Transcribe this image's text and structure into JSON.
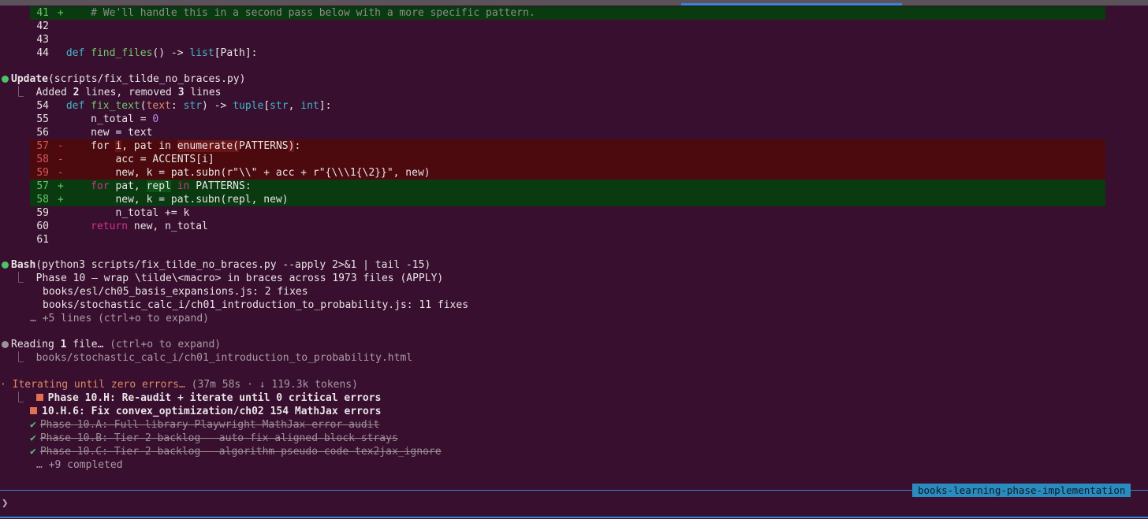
{
  "colors": {
    "background": "#380f2e",
    "added_bg": "#0a3a10",
    "removed_bg": "#4c0a0e",
    "accent": "#3a86d6",
    "branch_badge": "#2a8bbf",
    "success_dot": "#4cc26a",
    "task_square": "#e07050"
  },
  "diff1": {
    "lines": [
      {
        "num": "41",
        "mark": "+",
        "code": "# We'll handle this in a second pass below with a more specific pattern."
      },
      {
        "num": "42"
      },
      {
        "num": "43"
      },
      {
        "num": "44",
        "def": "def",
        "fname": "find_files",
        "rest1": "() -> ",
        "type": "list",
        "rest2": "[Path]:"
      }
    ]
  },
  "update": {
    "tool": "Update",
    "arg": "(scripts/fix_tilde_no_braces.py)",
    "summary_prefix": "Added ",
    "added": "2",
    "summary_mid": " lines, removed ",
    "removed": "3",
    "summary_suffix": " lines",
    "lines": [
      {
        "num": "54"
      },
      {
        "num": "55",
        "a": "    n_total = ",
        "b": "0"
      },
      {
        "num": "56",
        "a": "    new = text"
      },
      {
        "num": "57",
        "mark": "-"
      },
      {
        "num": "58",
        "mark": "-",
        "a": "        acc = ACCENTS[i]"
      },
      {
        "num": "59",
        "mark": "-",
        "a": "        new, k = pat.subn(r\"\\\\\" + acc + r\"{\\\\\\1{\\2}}\", new)"
      },
      {
        "num": "57",
        "mark": "+"
      },
      {
        "num": "58",
        "mark": "+",
        "a": "        new, k = pat.subn(repl, new)"
      },
      {
        "num": "59",
        "a": "        n_total += k"
      },
      {
        "num": "60"
      },
      {
        "num": "61"
      }
    ]
  },
  "bash": {
    "tool": "Bash",
    "arg": "(python3 scripts/fix_tilde_no_braces.py --apply 2>&1 | tail -15)",
    "out1": "Phase 10 — wrap \\tilde\\<macro> in braces across 1973 files (APPLY)",
    "out2": "books/esl/ch05_basis_expansions.js: 2 fixes",
    "out3": "books/stochastic_calc_i/ch01_introduction_to_probability.js: 11 fixes",
    "more": "… +5 lines (ctrl+o to expand)"
  },
  "reading": {
    "label": "Reading ",
    "count": "1",
    "suffix": " file…",
    "hint": " (ctrl+o to expand)",
    "path": "books/stochastic_calc_i/ch01_introduction_to_probability.html"
  },
  "status": {
    "text": "· Iterating until zero errors…",
    "meta": " (37m 58s · ↓ 119.3k tokens)"
  },
  "tasks": [
    {
      "label": "Phase 10.H: Re-audit + iterate until 0 critical errors"
    },
    {
      "label": "10.H.6: Fix convex_optimization/ch02 154 MathJax errors"
    },
    {
      "label": "Phase 10.A: Full library Playwright MathJax error audit"
    },
    {
      "label": "Phase 10.B: Tier 2 backlog — auto-fix aligned-block strays"
    },
    {
      "label": "Phase 10.C: Tier 2 backlog — algorithm pseudo-code tex2jax_ignore"
    }
  ],
  "tasks_more": "… +9 completed",
  "branch": "books-learning-phase-implementation",
  "prompt": "❯"
}
